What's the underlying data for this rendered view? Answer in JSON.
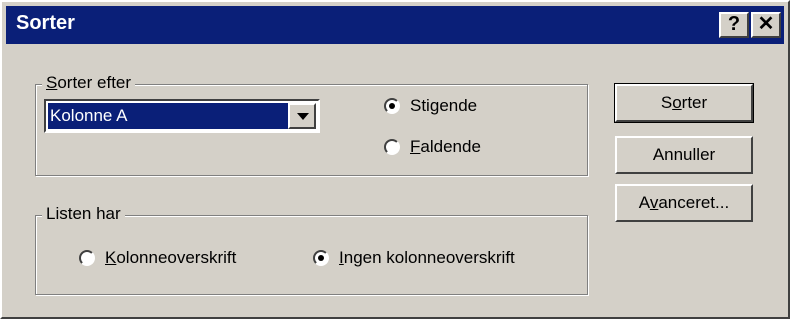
{
  "dialog": {
    "title": "Sorter",
    "help_label": "?",
    "close_label": "✕"
  },
  "sort_by": {
    "group_label_first": "S",
    "group_label_rest": "orter efter",
    "column_value": "Kolonne A",
    "ascending_first": "Sti",
    "ascending_u": "g",
    "ascending_rest": "ende",
    "descending_u": "F",
    "descending_rest": "aldende",
    "selected": "ascending"
  },
  "list_has": {
    "group_label": "Listen har",
    "header_u": "K",
    "header_rest": "olonneoverskrift",
    "no_header_u": "I",
    "no_header_rest": "ngen kolonneoverskrift",
    "selected": "no_header"
  },
  "buttons": {
    "sort_first": "S",
    "sort_u": "o",
    "sort_rest": "rter",
    "cancel": "Annuller",
    "advanced_first": "A",
    "advanced_u": "v",
    "advanced_rest": "anceret..."
  },
  "colors": {
    "title_bar": "#0a1f78",
    "face": "#d4d0c8"
  }
}
